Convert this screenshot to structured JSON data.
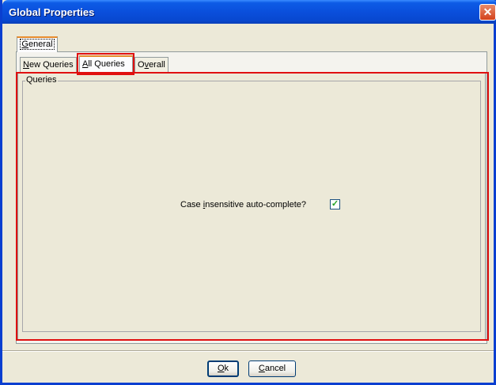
{
  "window": {
    "title": "Global Properties"
  },
  "outer_tabs": [
    {
      "label_u": "G",
      "label_rest": "eneral"
    }
  ],
  "inner_tabs": [
    {
      "label_u": "N",
      "label_rest": "ew Queries"
    },
    {
      "label_u": "A",
      "label_rest": "ll Queries"
    },
    {
      "label_pre": "O",
      "label_u": "v",
      "label_rest": "erall"
    }
  ],
  "group": {
    "title": "Queries"
  },
  "option": {
    "label_pre": "Case ",
    "label_u": "i",
    "label_rest": "nsensitive auto-complete?",
    "checked": true
  },
  "buttons": {
    "ok_u": "O",
    "ok_rest": "k",
    "cancel_u": "C",
    "cancel_rest": "ancel"
  },
  "colors": {
    "title_bar": "#0a4fdc",
    "highlight": "#e01010",
    "active_tab_accent": "#e68b2c"
  }
}
